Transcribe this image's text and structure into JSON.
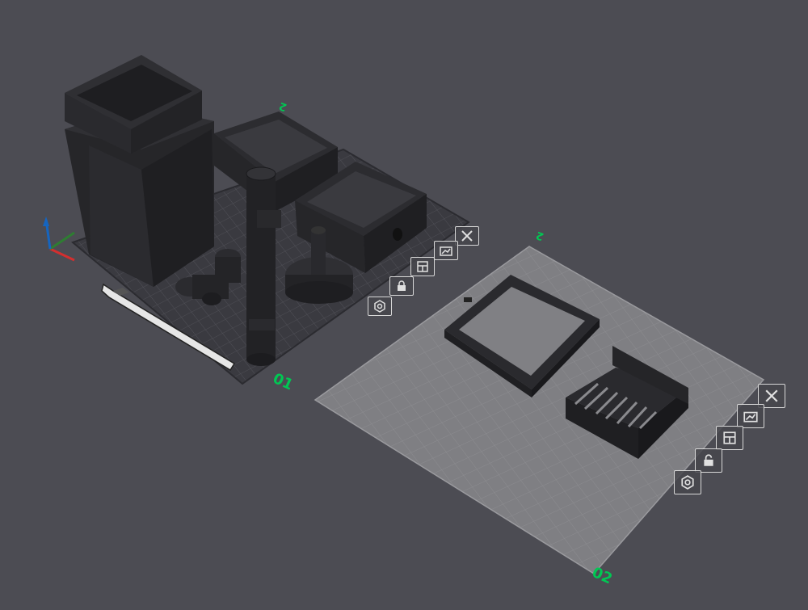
{
  "app": {
    "viewport_background": "#4c4c53"
  },
  "plates": [
    {
      "id": "01",
      "label": "01",
      "top_marker": "2",
      "surface_color": "#3a3a40",
      "selected": false,
      "tools": [
        {
          "name": "close",
          "icon": "close-icon",
          "tooltip": ""
        },
        {
          "name": "auto-orient",
          "icon": "auto-orient-icon",
          "tooltip": ""
        },
        {
          "name": "arrange",
          "icon": "arrange-icon",
          "tooltip": ""
        },
        {
          "name": "lock",
          "icon": "lock-icon",
          "tooltip": ""
        },
        {
          "name": "plate-settings",
          "icon": "gear-icon",
          "tooltip": ""
        }
      ]
    },
    {
      "id": "02",
      "label": "02",
      "top_marker": "2",
      "surface_color": "#7f7f83",
      "selected": true,
      "tools": [
        {
          "name": "close",
          "icon": "close-icon",
          "tooltip": ""
        },
        {
          "name": "auto-orient",
          "icon": "auto-orient-icon",
          "tooltip": ""
        },
        {
          "name": "arrange",
          "icon": "arrange-icon",
          "tooltip": ""
        },
        {
          "name": "lock",
          "icon": "lock-icon",
          "tooltip": ""
        },
        {
          "name": "plate-settings",
          "icon": "gear-icon",
          "tooltip": ""
        }
      ]
    }
  ],
  "axes": {
    "x_color": "#d32f2f",
    "y_color": "#2e7d32",
    "z_color": "#1565c0"
  },
  "colors": {
    "label_green": "#00c853",
    "model_dark": "#2a2a2e",
    "model_edge": "#1c1c1f"
  }
}
